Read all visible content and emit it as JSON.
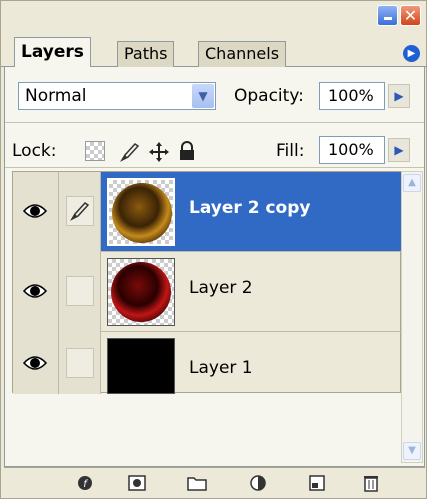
{
  "window": {
    "minimize_glyph": "",
    "close_glyph": "✕"
  },
  "tabs": [
    {
      "label": "Layers",
      "active": true
    },
    {
      "label": "Paths",
      "active": false
    },
    {
      "label": "Channels",
      "active": false
    }
  ],
  "tab_menu_icon": "flyout-arrow-icon",
  "controls": {
    "blend_mode": "Normal",
    "opacity_label": "Opacity:",
    "opacity_value": "100%",
    "lock_label": "Lock:",
    "fill_label": "Fill:",
    "fill_value": "100%"
  },
  "layers": [
    {
      "name": "Layer 2 copy",
      "visible": true,
      "selected": true,
      "brush_active": true,
      "thumb": "gold-disc"
    },
    {
      "name": "Layer 2",
      "visible": true,
      "selected": false,
      "brush_active": false,
      "thumb": "red-disc"
    },
    {
      "name": "Layer 1",
      "visible": true,
      "selected": false,
      "brush_active": false,
      "thumb": "black-fill"
    }
  ],
  "toolbar_icons": [
    "link-icon",
    "layer-style-icon",
    "layer-mask-icon",
    "folder-icon",
    "adjustment-layer-icon",
    "new-layer-icon",
    "trash-icon"
  ],
  "colors": {
    "selection": "#316ac5",
    "panel_bg": "#ece9d8",
    "content_bg": "#f6f5ee"
  }
}
